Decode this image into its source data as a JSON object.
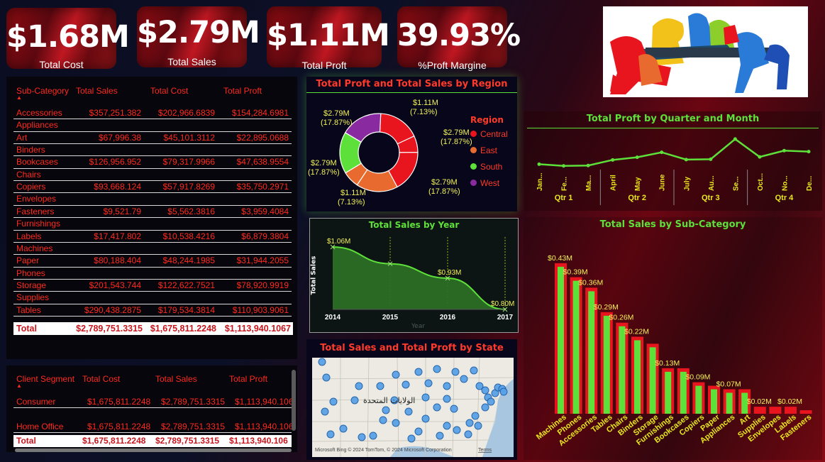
{
  "kpis": [
    {
      "value": "$1.68M",
      "label": "Total Cost"
    },
    {
      "value": "$2.79M",
      "label": "Total Sales"
    },
    {
      "value": "$1.11M",
      "label": "Total Proft"
    },
    {
      "value": "39.93%",
      "label": "%Proft Margine"
    }
  ],
  "subcat_table": {
    "headers": [
      "Sub-Category",
      "Total Sales",
      "Total Cost",
      "Total Proft"
    ],
    "rows": [
      [
        "Accessories",
        "$357,251.382",
        "$202,966.6839",
        "$154,284.6981"
      ],
      [
        "Appliances",
        "",
        "",
        ""
      ],
      [
        "Art",
        "$67,996.38",
        "$45,101.3112",
        "$22,895.0688"
      ],
      [
        "Binders",
        "",
        "",
        ""
      ],
      [
        "Bookcases",
        "$126,956.952",
        "$79,317.9966",
        "$47,638.9554"
      ],
      [
        "Chairs",
        "",
        "",
        ""
      ],
      [
        "Copiers",
        "$93,668.124",
        "$57,917.8269",
        "$35,750.2971"
      ],
      [
        "Envelopes",
        "",
        "",
        ""
      ],
      [
        "Fasteners",
        "$9,521.79",
        "$5,562.3816",
        "$3,959.4084"
      ],
      [
        "Furnishings",
        "",
        "",
        ""
      ],
      [
        "Labels",
        "$17,417.802",
        "$10,538.4216",
        "$6,879.3804"
      ],
      [
        "Machines",
        "",
        "",
        ""
      ],
      [
        "Paper",
        "$80,188.404",
        "$48,244.1985",
        "$31,944.2055"
      ],
      [
        "Phones",
        "",
        "",
        ""
      ],
      [
        "Storage",
        "$201,543.744",
        "$122,622.7521",
        "$78,920.9919"
      ],
      [
        "Supplies",
        "",
        "",
        ""
      ],
      [
        "Tables",
        "$290,438.2875",
        "$179,534.3814",
        "$110,903.9061"
      ]
    ],
    "total": [
      "Total",
      "$2,789,751.3315",
      "$1,675,811.2248",
      "$1,113,940.1067"
    ]
  },
  "segment_table": {
    "headers": [
      "Client Segment",
      "Total Cost",
      "Total Sales",
      "Total Proft"
    ],
    "rows": [
      [
        "Consumer",
        "$1,675,811.2248",
        "$2,789,751.3315",
        "$1,113,940.106"
      ],
      [
        "Home Office",
        "$1,675,811.2248",
        "$2,789,751.3315",
        "$1,113,940.106"
      ]
    ],
    "total": [
      "Total",
      "$1,675,811.2248",
      "$2,789,751.3315",
      "$1,113,940.106"
    ]
  },
  "chart_data": [
    {
      "type": "pie",
      "title": "Total Proft and Total Sales by Region",
      "legend_title": "Region",
      "legend_position": "right",
      "categories": [
        "Central",
        "East",
        "South",
        "West"
      ],
      "colors": [
        "#e8141e",
        "#e86a2e",
        "#5ee03a",
        "#8a2aa0"
      ],
      "slices": [
        {
          "label": "$2.79M",
          "pct": "(17.87%)",
          "value": 2.79,
          "color": "#e8141e"
        },
        {
          "label": "$1.11M",
          "pct": "(7.13%)",
          "value": 1.11,
          "color": "#e8141e"
        },
        {
          "label": "$2.79M",
          "pct": "(17.87%)",
          "value": 2.79,
          "color": "#e8141e"
        },
        {
          "label": "$2.79M",
          "pct": "(17.87%)",
          "value": 2.79,
          "color": "#e86a2e"
        },
        {
          "label": "$1.11M",
          "pct": "(7.13%)",
          "value": 1.11,
          "color": "#e86a2e"
        },
        {
          "label": "$2.79M",
          "pct": "(17.87%)",
          "value": 2.79,
          "color": "#5ee03a"
        },
        {
          "label": "$2.79M",
          "pct": "(17.87%)",
          "value": 2.79,
          "color": "#8a2aa0"
        }
      ]
    },
    {
      "type": "area",
      "title": "Total Sales by Year",
      "xlabel": "Year",
      "ylabel": "Total Sales",
      "x": [
        "2014",
        "2015",
        "2016",
        "2017"
      ],
      "values": [
        1.06,
        0.99,
        0.93,
        0.8
      ],
      "data_labels": [
        "$1.06M",
        "",
        "$0.93M",
        "$0.80M"
      ],
      "ylim": [
        0.8,
        1.06
      ],
      "color": "#5ee03a"
    },
    {
      "type": "line",
      "title": "Total Proft by Quarter and Month",
      "months": [
        "Jan...",
        "Fe...",
        "Ma...",
        "April",
        "May",
        "June",
        "July",
        "Au...",
        "Se...",
        "Oct...",
        "No...",
        "De..."
      ],
      "quarters": [
        "Qtr 1",
        "Qtr 2",
        "Qtr 3",
        "Qtr 4"
      ],
      "values": [
        0.052,
        0.047,
        0.048,
        0.065,
        0.073,
        0.088,
        0.066,
        0.067,
        0.128,
        0.074,
        0.093,
        0.09
      ],
      "color": "#5ee03a"
    },
    {
      "type": "bar",
      "title": "Total Sales by Sub-Category",
      "categories": [
        "Machines",
        "Phones",
        "Accessories",
        "Tables",
        "Chairs",
        "Binders",
        "Storage",
        "Furnishings",
        "Bookcases",
        "Copiers",
        "Paper",
        "Appliances",
        "Art",
        "Supplies",
        "Envelopes",
        "Labels",
        "Fasteners"
      ],
      "values": [
        0.43,
        0.39,
        0.36,
        0.29,
        0.26,
        0.22,
        0.2,
        0.13,
        0.13,
        0.09,
        0.08,
        0.07,
        0.07,
        0.02,
        0.02,
        0.02,
        0.01
      ],
      "data_labels": [
        "$0.43M",
        "$0.39M",
        "$0.36M",
        "$0.29M",
        "$0.26M",
        "$0.22M",
        "",
        "$0.13M",
        "",
        "$0.09M",
        "",
        "$0.07M",
        "",
        "$0.02M",
        "",
        "$0.02M",
        ""
      ],
      "ylim": [
        0,
        0.45
      ],
      "colors": {
        "fill": "#5ee03a",
        "edge": "#e8141e"
      }
    }
  ],
  "map": {
    "title": "Total Sales and Total Proft by State",
    "country_label": "الولايات المتحدة",
    "attribution": "Microsoft Bing   © 2024 TomTom, © 2024 Microsoft Corporation",
    "terms": "Terms"
  }
}
